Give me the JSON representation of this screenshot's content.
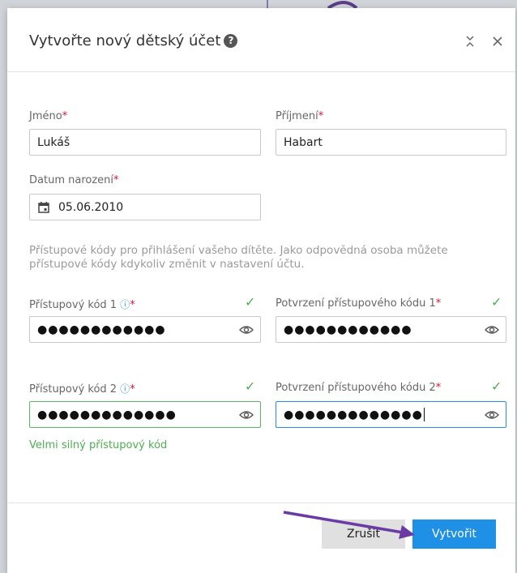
{
  "dialog": {
    "title": "Vytvořte nový dětský účet",
    "help_icon": "?"
  },
  "form": {
    "first_name": {
      "label": "Jméno",
      "required_mark": "*",
      "value": "Lukáš"
    },
    "last_name": {
      "label": "Příjmení",
      "required_mark": "*",
      "value": "Habart"
    },
    "birth_date": {
      "label": "Datum narození",
      "required_mark": "*",
      "value": "05.06.2010"
    },
    "note": "Přístupové kódy pro přihlášení vašeho dítěte. Jako odpovědná osoba můžete přístupové kódy kdykoliv změnit v nastavení účtu.",
    "code1": {
      "label": "Přístupový kód 1",
      "info_icon": "ⓘ",
      "required_mark": "*",
      "masked_value": "●●●●●●●●●●●●"
    },
    "confirm1": {
      "label": "Potvrzení přístupového kódu 1",
      "required_mark": "*",
      "masked_value": "●●●●●●●●●●●●"
    },
    "code2": {
      "label": "Přístupový kód 2",
      "info_icon": "ⓘ",
      "required_mark": "*",
      "masked_value": "●●●●●●●●●●●●●"
    },
    "confirm2": {
      "label": "Potvrzení přístupového kódu 2",
      "required_mark": "*",
      "masked_value": "●●●●●●●●●●●●●"
    },
    "strength": "Velmi silný přístupový kód",
    "check": "✓"
  },
  "buttons": {
    "cancel": "Zrušit",
    "create": "Vytvořit"
  },
  "colors": {
    "primary": "#1e90e6",
    "success": "#4caf50",
    "required": "#d3163a",
    "annotation_arrow": "#6a3aa5"
  }
}
